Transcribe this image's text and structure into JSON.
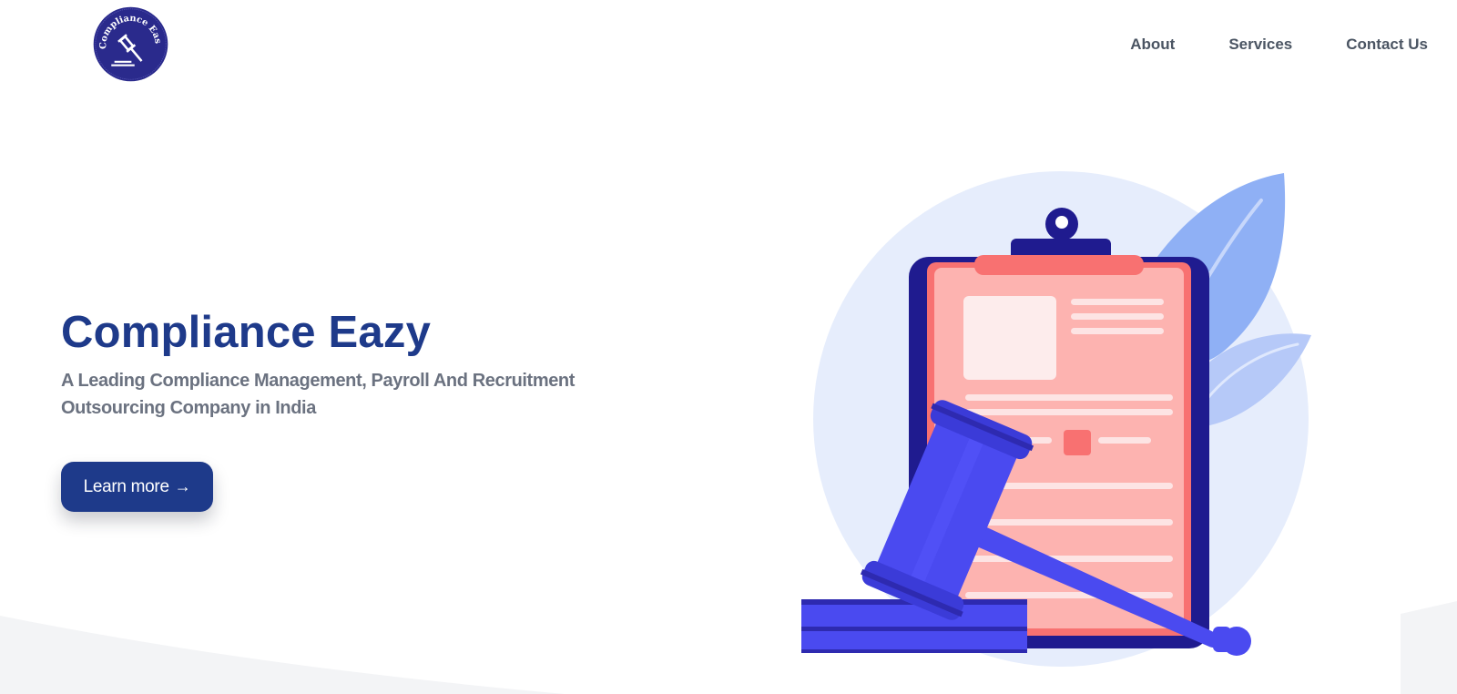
{
  "logo": {
    "text": "Compliance Easy",
    "icon": "gavel-icon"
  },
  "nav": {
    "items": [
      {
        "label": "About"
      },
      {
        "label": "Services"
      },
      {
        "label": "Contact Us"
      }
    ]
  },
  "hero": {
    "title": "Compliance Eazy",
    "subtitle": "A Leading Compliance Management, Payroll And Recruitment Outsourcing Company in India",
    "cta_label": "Learn more",
    "cta_icon": "arrow-right-icon"
  },
  "illustration": {
    "icons": [
      "clipboard-icon",
      "gavel-icon",
      "leaf-icon"
    ]
  },
  "colors": {
    "primary": "#1e3a8a",
    "nav_text": "#4b5563",
    "subtitle_text": "#6b7280",
    "logo_bg": "#2a2a8c",
    "gavel": "#4a4af0",
    "clipboard_paper": "#fdb3b0",
    "leaf": "#8fb0f5",
    "blob": "#e6edfc"
  }
}
